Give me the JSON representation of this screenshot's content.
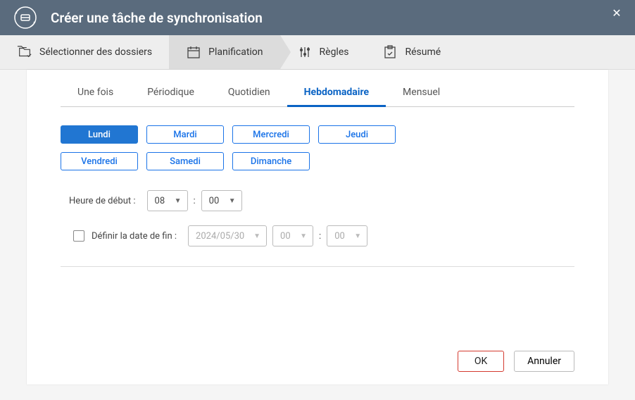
{
  "header": {
    "title": "Créer une tâche de synchronisation"
  },
  "wizard": {
    "steps": [
      {
        "label": "Sélectionner des dossiers"
      },
      {
        "label": "Planification"
      },
      {
        "label": "Règles"
      },
      {
        "label": "Résumé"
      }
    ]
  },
  "tabs": [
    {
      "label": "Une fois"
    },
    {
      "label": "Périodique"
    },
    {
      "label": "Quotidien"
    },
    {
      "label": "Hebdomadaire"
    },
    {
      "label": "Mensuel"
    }
  ],
  "days": [
    {
      "label": "Lundi",
      "selected": true
    },
    {
      "label": "Mardi",
      "selected": false
    },
    {
      "label": "Mercredi",
      "selected": false
    },
    {
      "label": "Jeudi",
      "selected": false
    },
    {
      "label": "Vendredi",
      "selected": false
    },
    {
      "label": "Samedi",
      "selected": false
    },
    {
      "label": "Dimanche",
      "selected": false
    }
  ],
  "start_time": {
    "label": "Heure de début :",
    "hour": "08",
    "minute": "00"
  },
  "end_date": {
    "label": "Définir la date de fin :",
    "checked": false,
    "date": "2024/05/30",
    "hour": "00",
    "minute": "00"
  },
  "buttons": {
    "ok": "OK",
    "cancel": "Annuler"
  }
}
